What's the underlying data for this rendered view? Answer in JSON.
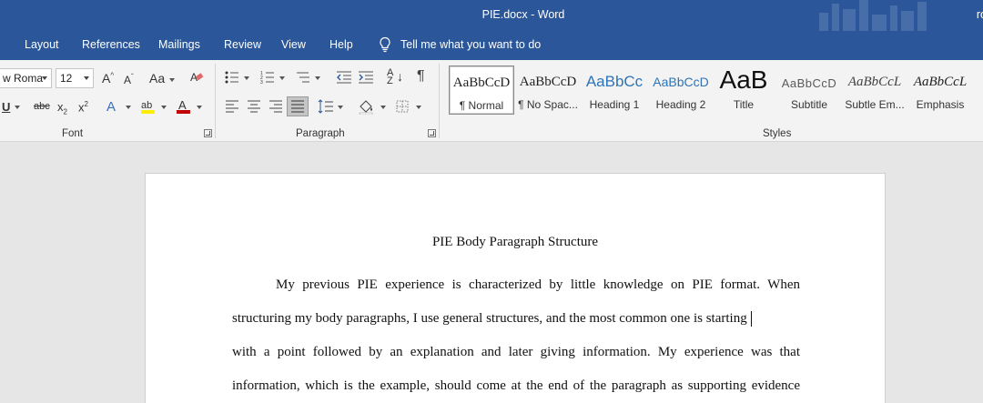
{
  "titlebar": {
    "title": "PIE.docx  -  Word",
    "user": "ro"
  },
  "menu": {
    "tabs": [
      "Layout",
      "References",
      "Mailings",
      "Review",
      "View",
      "Help"
    ],
    "tell_me": "Tell me what you want to do"
  },
  "font": {
    "name": "w Roma",
    "size": "12",
    "group_label": "Font"
  },
  "paragraph": {
    "group_label": "Paragraph"
  },
  "styles": {
    "group_label": "Styles",
    "items": [
      {
        "sample": "AaBbCcD",
        "name": "¶ Normal"
      },
      {
        "sample": "AaBbCcD",
        "name": "¶ No Spac..."
      },
      {
        "sample": "AaBbCc",
        "name": "Heading 1"
      },
      {
        "sample": "AaBbCcD",
        "name": "Heading 2"
      },
      {
        "sample": "AaB",
        "name": "Title"
      },
      {
        "sample": "AaBbCcD",
        "name": "Subtitle"
      },
      {
        "sample": "AaBbCcL",
        "name": "Subtle Em..."
      },
      {
        "sample": "AaBbCcL",
        "name": "Emphasis"
      }
    ]
  },
  "document": {
    "title": "PIE Body Paragraph Structure",
    "lines": [
      "My previous PIE experience is characterized by little knowledge on PIE format. When",
      "structuring my body paragraphs, I use general structures, and the most common one is starting",
      "with a point followed by an explanation and later giving information. My experience was that",
      "information, which is the example, should come at the end of the paragraph as supporting evidence"
    ]
  }
}
